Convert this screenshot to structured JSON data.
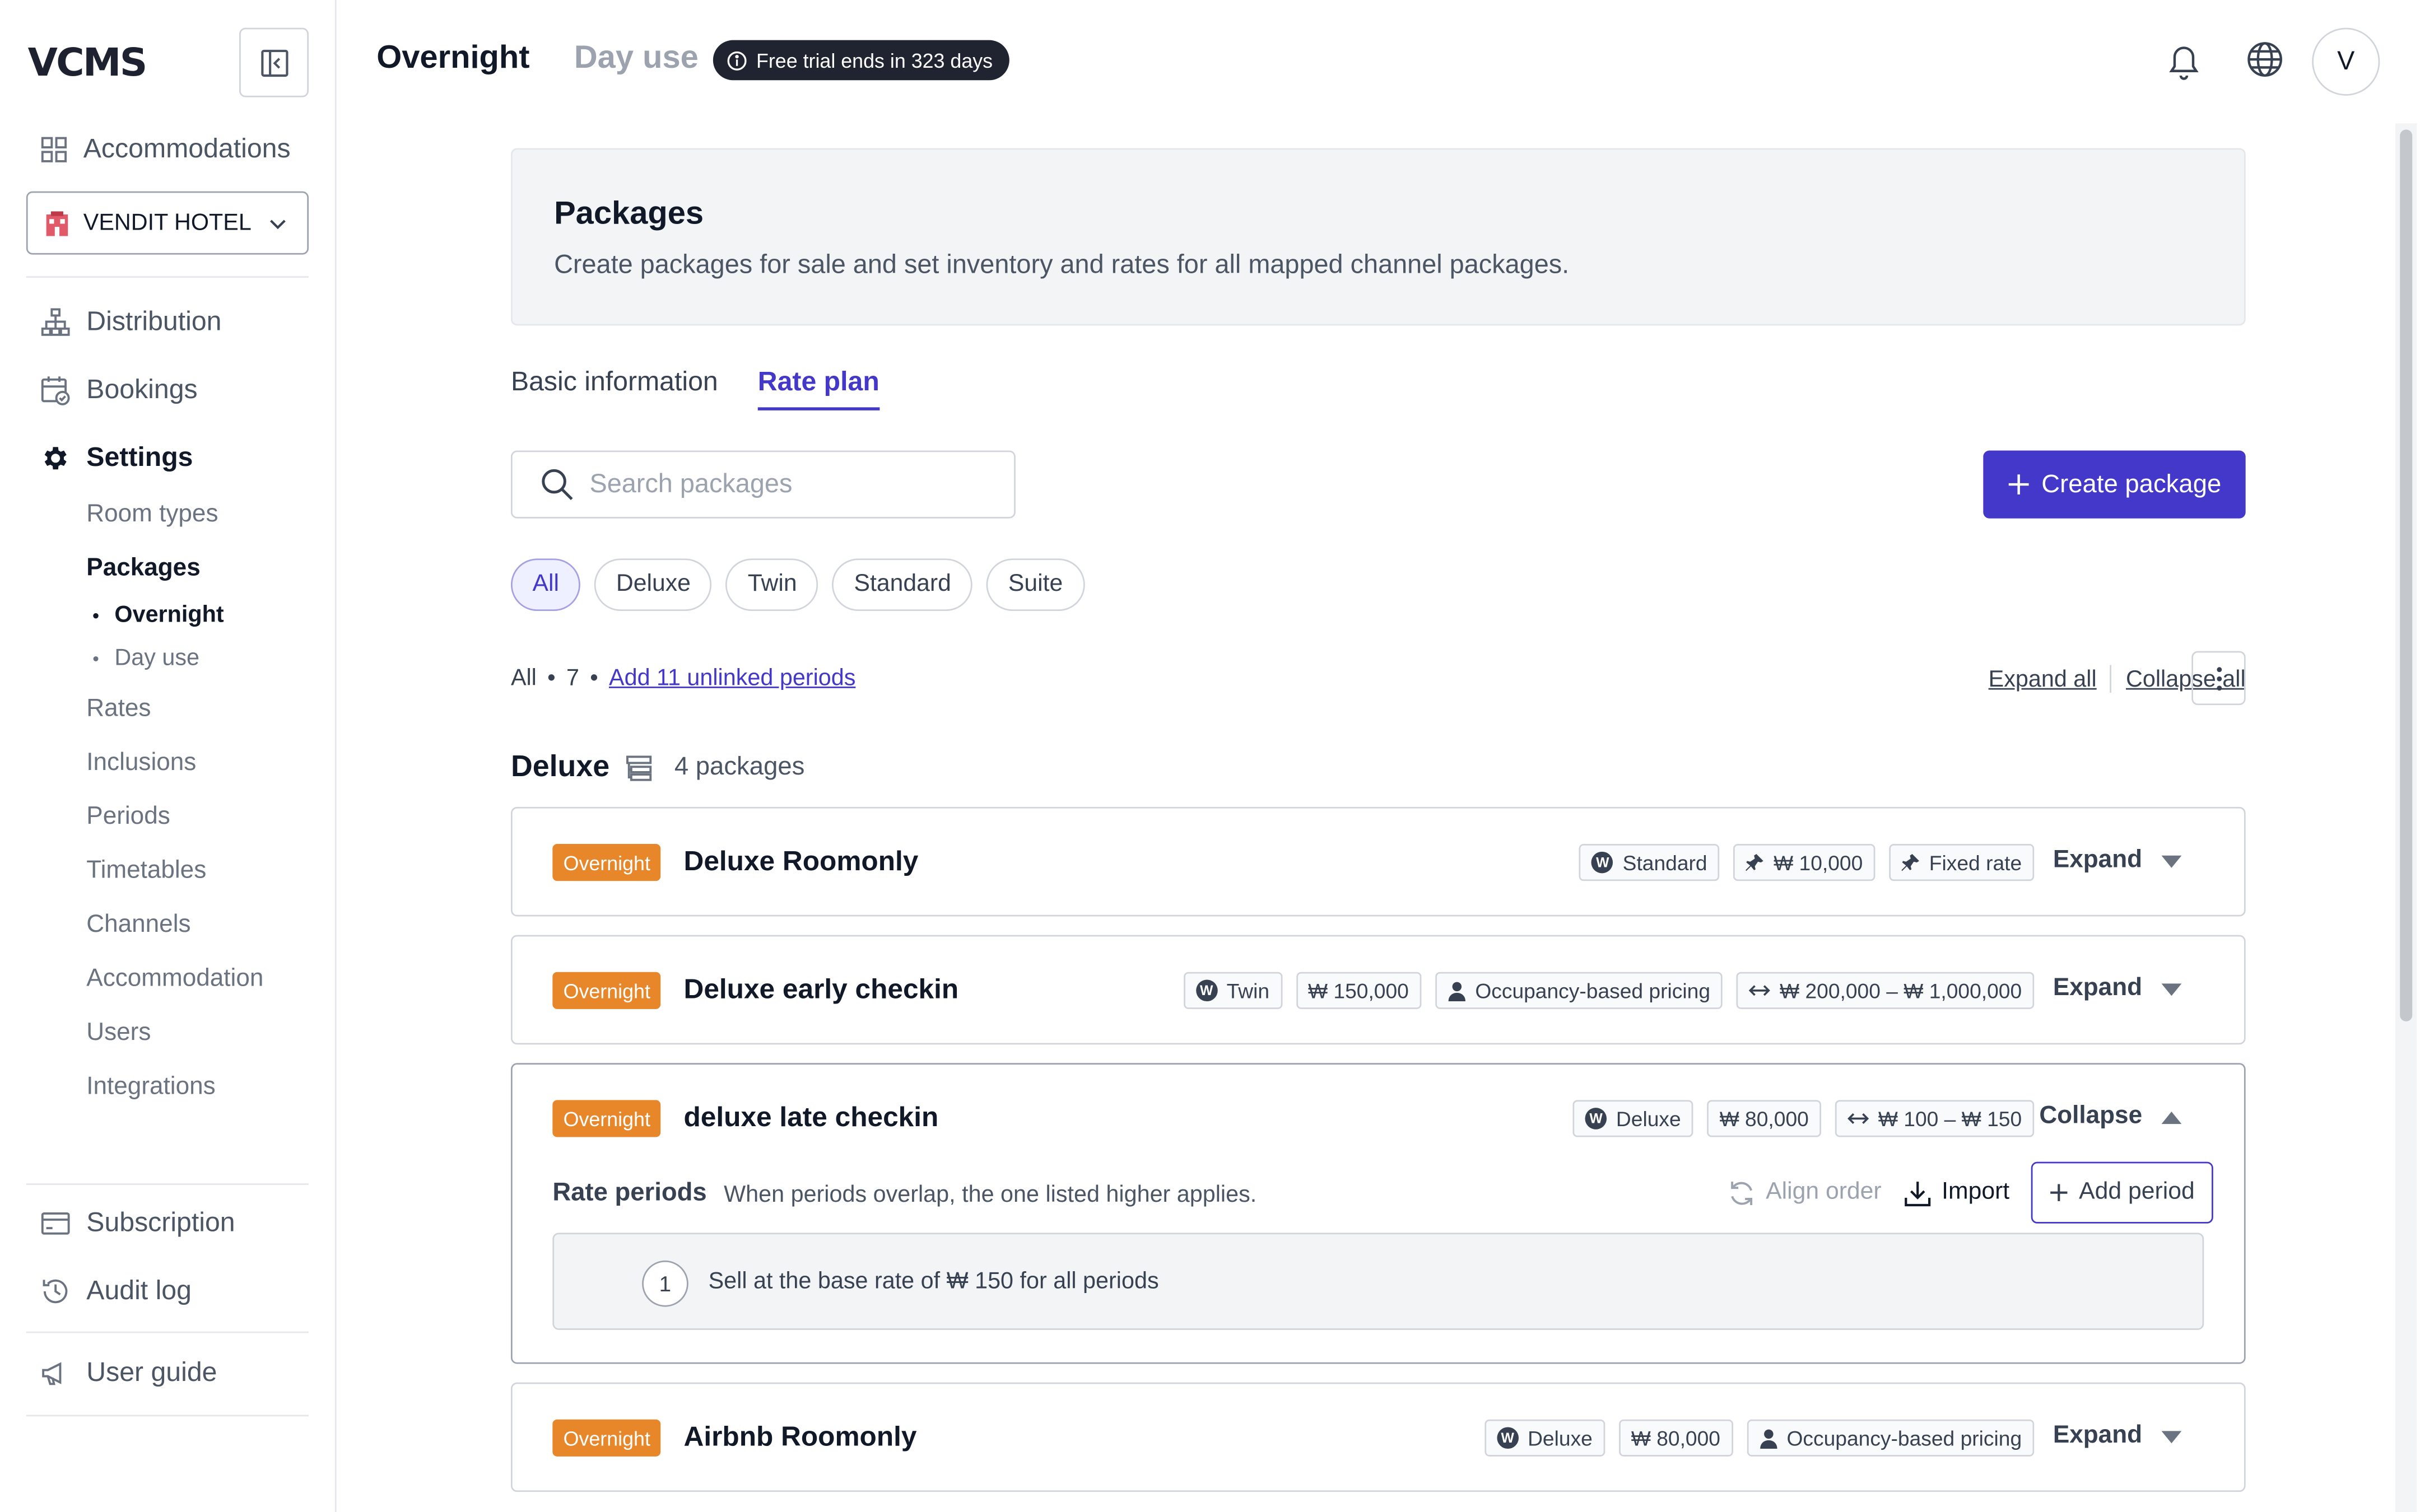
{
  "app": {
    "logo": "VCMS"
  },
  "sidebar": {
    "accommodations_label": "Accommodations",
    "hotel": {
      "name": "VENDIT HOTEL"
    },
    "nav": [
      {
        "label": "Distribution"
      },
      {
        "label": "Bookings"
      },
      {
        "label": "Settings"
      }
    ],
    "settings_items": [
      {
        "label": "Room types"
      },
      {
        "label": "Packages"
      },
      {
        "label": "Rates"
      },
      {
        "label": "Inclusions"
      },
      {
        "label": "Periods"
      },
      {
        "label": "Timetables"
      },
      {
        "label": "Channels"
      },
      {
        "label": "Accommodation"
      },
      {
        "label": "Users"
      },
      {
        "label": "Integrations"
      }
    ],
    "packages_sub": [
      {
        "label": "Overnight",
        "active": true
      },
      {
        "label": "Day use",
        "active": false
      }
    ],
    "bottom": [
      {
        "label": "Subscription"
      },
      {
        "label": "Audit log"
      },
      {
        "label": "User guide"
      }
    ]
  },
  "header": {
    "tabs": [
      {
        "label": "Overnight",
        "active": true
      },
      {
        "label": "Day use",
        "active": false
      }
    ],
    "trial_text": "Free trial ends in 323 days",
    "avatar_initial": "V"
  },
  "banner": {
    "title": "Packages",
    "description": "Create packages for sale and set inventory and rates for all mapped channel packages."
  },
  "tabs": [
    {
      "label": "Basic information",
      "active": false
    },
    {
      "label": "Rate plan",
      "active": true
    }
  ],
  "search": {
    "placeholder": "Search packages",
    "value": ""
  },
  "create_button": "Create package",
  "filters": [
    {
      "label": "All",
      "selected": true
    },
    {
      "label": "Deluxe",
      "selected": false
    },
    {
      "label": "Twin",
      "selected": false
    },
    {
      "label": "Standard",
      "selected": false
    },
    {
      "label": "Suite",
      "selected": false
    }
  ],
  "summary": {
    "scope": "All",
    "count": "7",
    "link": "Add 11 unlinked periods"
  },
  "list_actions": {
    "expand_all": "Expand all",
    "collapse_all": "Collapse all"
  },
  "group": {
    "name": "Deluxe",
    "count_label": "4 packages"
  },
  "packages": [
    {
      "type": "Overnight",
      "name": "Deluxe Roomonly",
      "tags": [
        {
          "icon": "won-circle-icon",
          "text": "Standard"
        },
        {
          "icon": "pin-icon",
          "text": "₩ 10,000"
        },
        {
          "icon": "pin-icon",
          "text": "Fixed rate"
        }
      ],
      "toggle": "Expand"
    },
    {
      "type": "Overnight",
      "name": "Deluxe early checkin",
      "tags": [
        {
          "icon": "won-circle-icon",
          "text": "Twin"
        },
        {
          "icon": "",
          "text": "₩ 150,000"
        },
        {
          "icon": "person-icon",
          "text": "Occupancy-based pricing"
        },
        {
          "icon": "range-icon",
          "text": "₩ 200,000 – ₩ 1,000,000"
        }
      ],
      "toggle": "Expand"
    },
    {
      "type": "Overnight",
      "name": "deluxe late checkin",
      "tags": [
        {
          "icon": "won-circle-icon",
          "text": "Deluxe"
        },
        {
          "icon": "",
          "text": "₩ 80,000"
        },
        {
          "icon": "range-icon",
          "text": "₩ 100 – ₩ 150"
        }
      ],
      "toggle": "Collapse",
      "rate_periods": {
        "title": "Rate periods",
        "note": "When periods overlap, the one listed higher applies.",
        "align_order": "Align order",
        "import": "Import",
        "add_period": "Add period",
        "items": [
          {
            "index": "1",
            "text": "Sell at the base rate of ₩ 150 for all periods"
          }
        ]
      }
    },
    {
      "type": "Overnight",
      "name": "Airbnb Roomonly",
      "tags": [
        {
          "icon": "won-circle-icon",
          "text": "Deluxe"
        },
        {
          "icon": "",
          "text": "₩ 80,000"
        },
        {
          "icon": "person-icon",
          "text": "Occupancy-based pricing"
        }
      ],
      "toggle": "Expand"
    }
  ],
  "colors": {
    "accent": "#4338ca",
    "badge": "#e8862a",
    "trial_bg": "#1f2430"
  }
}
